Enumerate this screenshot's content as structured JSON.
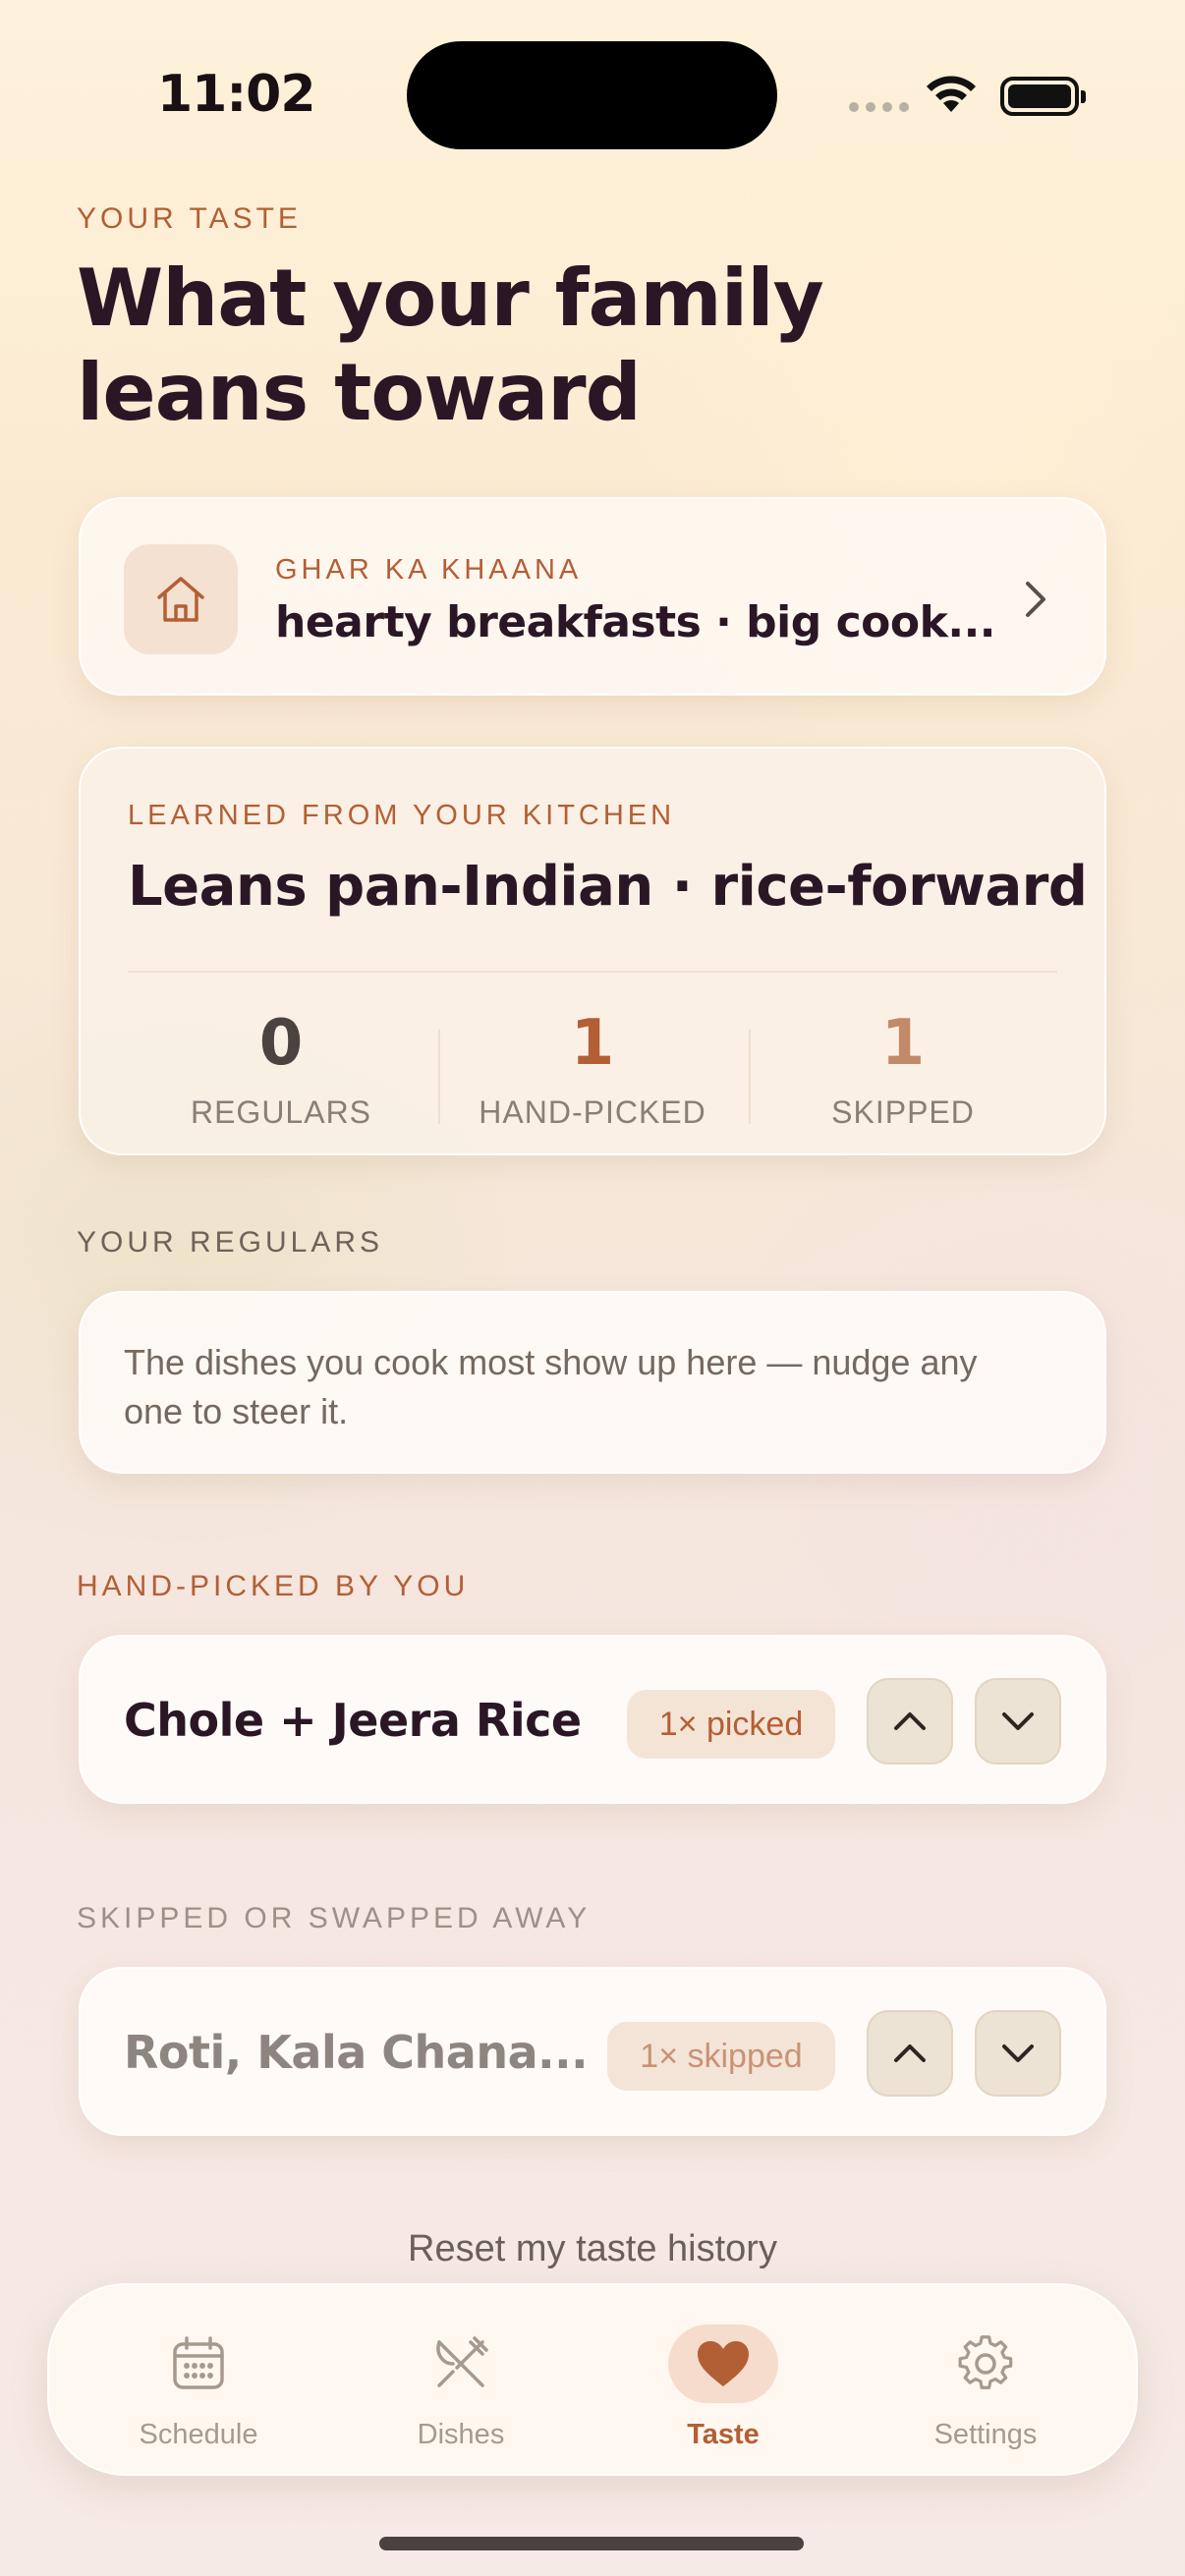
{
  "status_bar": {
    "time": "11:02"
  },
  "header": {
    "eyebrow": "YOUR TASTE",
    "title_line1": "What your family",
    "title_line2": "leans toward"
  },
  "household": {
    "label": "GHAR KA KHAANA",
    "value": "hearty breakfasts · big cook..."
  },
  "learned": {
    "label": "LEARNED FROM YOUR KITCHEN",
    "value": "Leans pan-Indian · rice-forward",
    "stats": [
      {
        "number": "0",
        "label": "REGULARS"
      },
      {
        "number": "1",
        "label": "HAND-PICKED"
      },
      {
        "number": "1",
        "label": "SKIPPED"
      }
    ]
  },
  "regulars": {
    "label": "YOUR REGULARS",
    "empty_text": "The dishes you cook most show up here — nudge any one to steer it."
  },
  "hand_picked": {
    "label": "HAND-PICKED BY YOU",
    "items": [
      {
        "name": "Chole + Jeera Rice",
        "badge": "1× picked"
      }
    ]
  },
  "skipped": {
    "label": "SKIPPED OR SWAPPED AWAY",
    "items": [
      {
        "name": "Roti, Kala Chana...",
        "badge": "1× skipped"
      }
    ]
  },
  "reset_label": "Reset my taste history",
  "tabs": [
    {
      "label": "Schedule",
      "icon": "calendar-icon"
    },
    {
      "label": "Dishes",
      "icon": "fork-knife-icon"
    },
    {
      "label": "Taste",
      "icon": "heart-icon",
      "active": true
    },
    {
      "label": "Settings",
      "icon": "gear-icon"
    }
  ],
  "colors": {
    "accent": "#b35f35",
    "ink": "#2b1626",
    "muted": "#8a7f78"
  }
}
